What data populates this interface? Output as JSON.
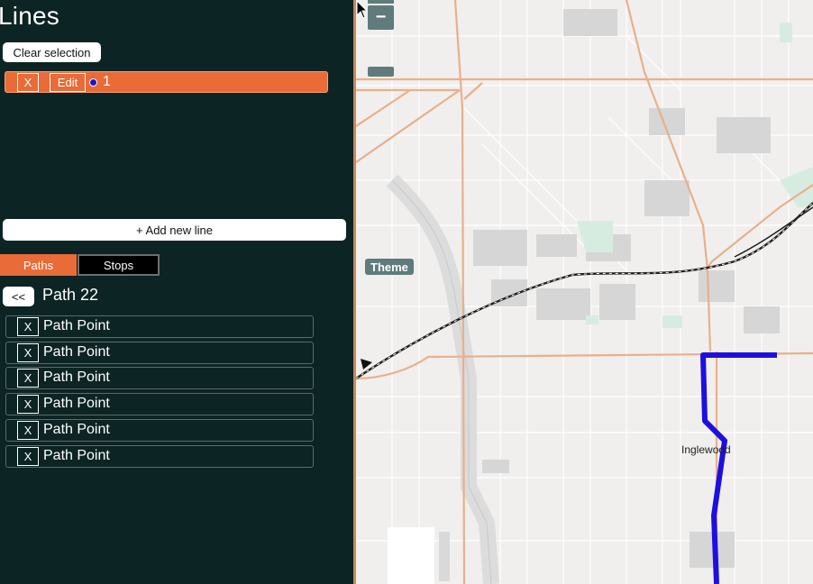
{
  "panel": {
    "title": "Lines",
    "clear_selection_label": "Clear selection",
    "line": {
      "remove_label": "X",
      "edit_label": "Edit",
      "name": "1",
      "color": "#1a12d6",
      "row_color": "#e96b37"
    },
    "add_line_label": "+ Add new line",
    "tabs": {
      "paths_label": "Paths",
      "stops_label": "Stops",
      "active": "Paths"
    },
    "back_label": "<<",
    "path_title": "Path 22",
    "path_points": [
      {
        "remove_label": "X",
        "label": "Path Point"
      },
      {
        "remove_label": "X",
        "label": "Path Point"
      },
      {
        "remove_label": "X",
        "label": "Path Point"
      },
      {
        "remove_label": "X",
        "label": "Path Point"
      },
      {
        "remove_label": "X",
        "label": "Path Point"
      },
      {
        "remove_label": "X",
        "label": "Path Point"
      }
    ]
  },
  "map": {
    "zoom_out_label": "−",
    "theme_label": "Theme",
    "place_label": "Inglewood",
    "route_color": "#1e0fe0",
    "road_color": "#e8b08a",
    "rail_color": "#1f1f1f",
    "park_color": "#d7ece1"
  }
}
